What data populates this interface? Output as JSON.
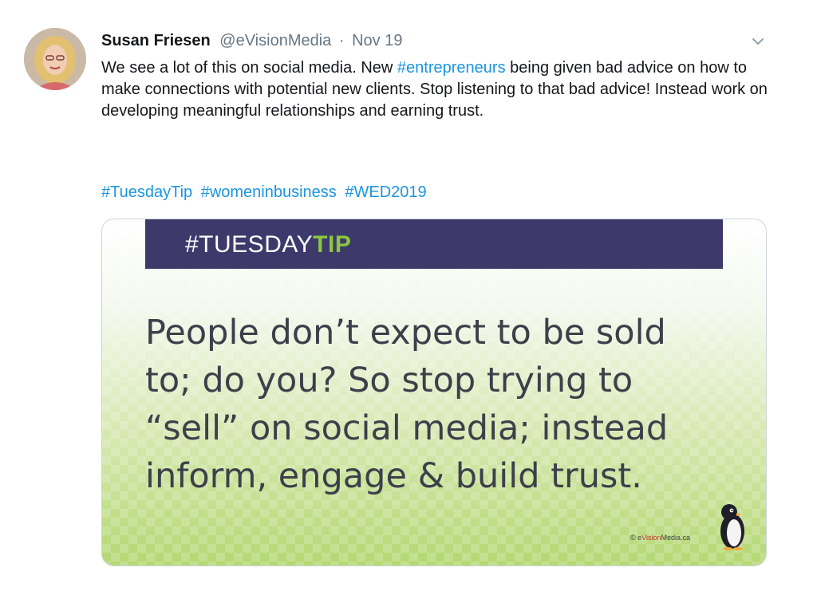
{
  "tweet": {
    "display_name": "Susan Friesen",
    "handle": "@eVisionMedia",
    "separator": "·",
    "date": "Nov 19",
    "body": {
      "part1": "We see a lot of this on social media. New ",
      "hashtag": "#entrepreneurs",
      "part2": " being given bad advice on how to make connections with potential new clients. Stop listening to that bad advice! Instead work on developing meaningful relationships and earning trust."
    },
    "hashtags": [
      "#TuesdayTip",
      "#womeninbusiness",
      "#WED2019"
    ],
    "icons": {
      "avatar": "profile-photo",
      "caret": "chevron-down-icon"
    }
  },
  "card": {
    "banner_prefix": "#TUESDAY",
    "banner_accent": "TIP",
    "quote_lines": [
      "People don’t expect to be sold",
      "to; do you? So stop trying to",
      "“sell” on social media; instead",
      "inform, engage & build trust."
    ],
    "watermark_prefix": "© e",
    "watermark_brand": "Vision",
    "watermark_suffix": "Media.ca",
    "logo_icon": "penguin-logo-icon"
  },
  "colors": {
    "link": "#1b95e0",
    "banner_bg": "#3d3a6b",
    "banner_accent": "#8dc63f",
    "quote_text": "#3d3f4a",
    "muted": "#657786"
  }
}
